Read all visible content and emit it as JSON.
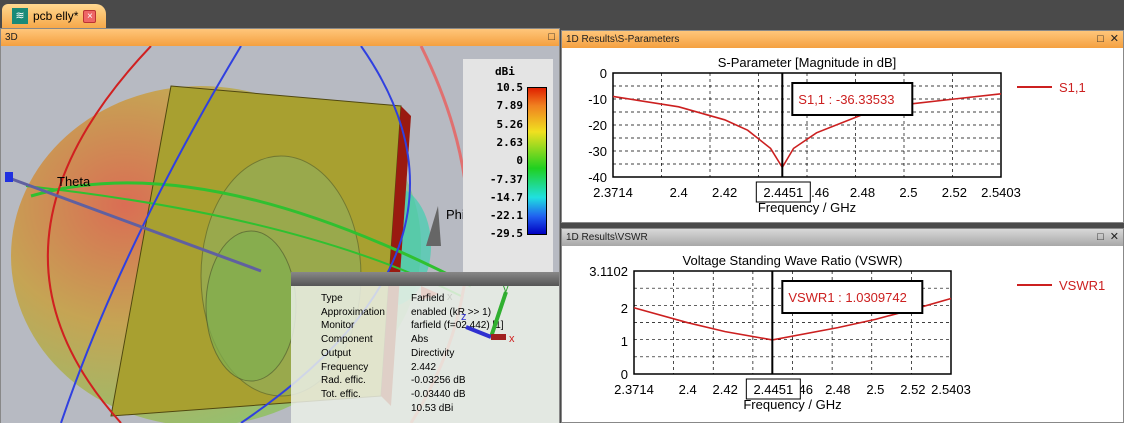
{
  "tab": {
    "title": "pcb elly*",
    "icon": "antenna-icon"
  },
  "view3d": {
    "title": "3D",
    "axis_labels": {
      "theta": "Theta",
      "phi": "Phi",
      "x": "x",
      "y": "y",
      "z": "z"
    },
    "colorbar": {
      "unit": "dBi",
      "ticks": [
        "10.5",
        "7.89",
        "5.26",
        "2.63",
        "0",
        "-7.37",
        "-14.7",
        "-22.1",
        "-29.5"
      ]
    },
    "info": [
      {
        "k": "Type",
        "v": "Farfield"
      },
      {
        "k": "Approximation",
        "v": "enabled (kR >> 1)"
      },
      {
        "k": "Monitor",
        "v": "farfield (f=02.442) [1]"
      },
      {
        "k": "Component",
        "v": "Abs"
      },
      {
        "k": "Output",
        "v": "Directivity"
      },
      {
        "k": "Frequency",
        "v": "2.442"
      },
      {
        "k": "Rad. effic.",
        "v": "-0.03256 dB"
      },
      {
        "k": "Tot. effic.",
        "v": "-0.03440 dB"
      },
      {
        "k": "",
        "v": "10.53 dBi"
      }
    ]
  },
  "sparam": {
    "panel_title": "1D Results\\S-Parameters",
    "marker_label": "S1,1 : -36.33533",
    "marker_x": "2.4451"
  },
  "vswr": {
    "panel_title": "1D Results\\VSWR",
    "marker_label": "VSWR1 : 1.0309742",
    "marker_x": "2.4451"
  },
  "chart_data": [
    {
      "type": "line",
      "title": "S-Parameter [Magnitude in dB]",
      "xlabel": "Frequency / GHz",
      "ylabel": "",
      "xlim": [
        2.3714,
        2.5403
      ],
      "ylim": [
        -40,
        0
      ],
      "xticks": [
        "2.3714",
        "2.4",
        "2.42",
        "2.46",
        "2.48",
        "2.5",
        "2.52",
        "2.5403"
      ],
      "yticks": [
        "0",
        "-10",
        "-20",
        "-30",
        "-40"
      ],
      "legend": "right",
      "grid": true,
      "series": [
        {
          "name": "S1,1",
          "color": "#cc2020",
          "x": [
            2.3714,
            2.4,
            2.42,
            2.43,
            2.44,
            2.4451,
            2.45,
            2.46,
            2.48,
            2.5,
            2.52,
            2.5403
          ],
          "y": [
            -9,
            -13,
            -18,
            -22,
            -29,
            -36.3,
            -29,
            -23,
            -16,
            -12,
            -10,
            -8
          ]
        }
      ]
    },
    {
      "type": "line",
      "title": "Voltage Standing Wave Ratio (VSWR)",
      "xlabel": "Frequency / GHz",
      "ylabel": "",
      "xlim": [
        2.3714,
        2.5403
      ],
      "ylim": [
        0,
        3.1102
      ],
      "xticks": [
        "2.3714",
        "2.4",
        "2.42",
        "2.46",
        "2.48",
        "2.5",
        "2.52",
        "2.5403"
      ],
      "yticks": [
        "3.1102",
        "2",
        "1",
        "0"
      ],
      "legend": "right",
      "grid": true,
      "series": [
        {
          "name": "VSWR1",
          "color": "#cc2020",
          "x": [
            2.3714,
            2.4,
            2.42,
            2.4451,
            2.48,
            2.5,
            2.52,
            2.5403
          ],
          "y": [
            2.0,
            1.55,
            1.28,
            1.03,
            1.4,
            1.65,
            1.95,
            2.28
          ]
        }
      ]
    }
  ]
}
